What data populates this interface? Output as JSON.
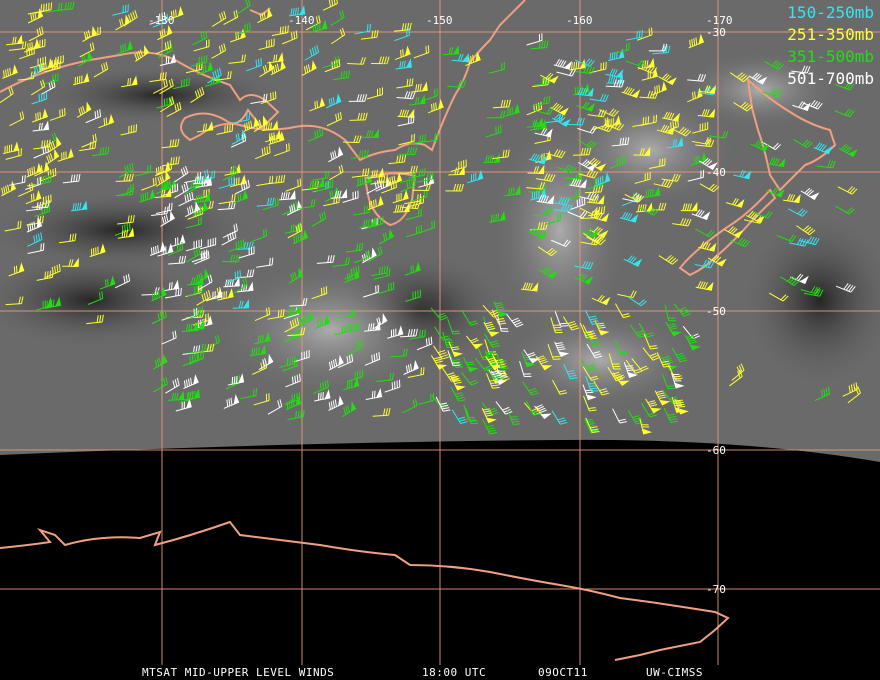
{
  "map": {
    "longitude_labels": [
      "-130",
      "-140",
      "-150",
      "-160",
      "-170"
    ],
    "latitude_labels": [
      "-30",
      "-40",
      "-50",
      "-60",
      "-70"
    ],
    "colors": {
      "grid": "#e89a7a",
      "coast": "#f0a080",
      "ocean_dark": "#111111",
      "imagery": "#6a6a6a",
      "space": "#000000"
    }
  },
  "legend": [
    {
      "label": "150-250mb",
      "color": "#33e6f0"
    },
    {
      "label": "251-350mb",
      "color": "#ffff33"
    },
    {
      "label": "351-500mb",
      "color": "#22dd11"
    },
    {
      "label": "501-700mb",
      "color": "#ffffff"
    }
  ],
  "footer": {
    "product": "MTSAT MID-UPPER LEVEL WINDS",
    "time": "18:00 UTC",
    "date": "09OCT11",
    "source": "UW-CIMSS"
  }
}
